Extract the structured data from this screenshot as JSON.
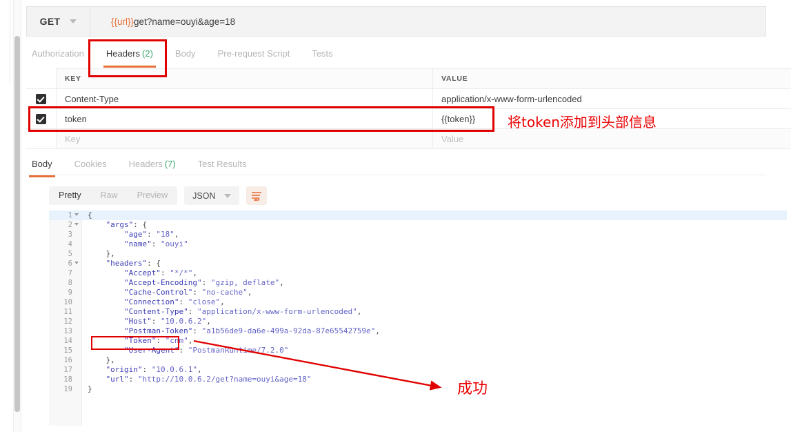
{
  "request": {
    "method": "GET",
    "url_variable": "{{url}}",
    "url_path": "get?name=ouyi&age=18",
    "tabs": [
      {
        "label": "Authorization",
        "count": "",
        "active": false
      },
      {
        "label": "Headers",
        "count": "(2)",
        "active": true
      },
      {
        "label": "Body",
        "count": "",
        "active": false
      },
      {
        "label": "Pre-request Script",
        "count": "",
        "active": false
      },
      {
        "label": "Tests",
        "count": "",
        "active": false
      }
    ]
  },
  "headers_table": {
    "columns": [
      "KEY",
      "VALUE"
    ],
    "rows": [
      {
        "checked": true,
        "key": "Content-Type",
        "value": "application/x-www-form-urlencoded",
        "value_is_variable": false,
        "placeholder": false
      },
      {
        "checked": true,
        "key": "token",
        "value": "{{token}}",
        "value_is_variable": true,
        "placeholder": false
      },
      {
        "checked": false,
        "key": "Key",
        "value": "Value",
        "value_is_variable": false,
        "placeholder": true
      }
    ]
  },
  "response": {
    "tabs": [
      {
        "label": "Body",
        "count": "",
        "active": true
      },
      {
        "label": "Cookies",
        "count": "",
        "active": false
      },
      {
        "label": "Headers",
        "count": "(7)",
        "active": false
      },
      {
        "label": "Test Results",
        "count": "",
        "active": false
      }
    ],
    "view_modes": [
      {
        "label": "Pretty",
        "active": true
      },
      {
        "label": "Raw",
        "active": false
      },
      {
        "label": "Preview",
        "active": false
      }
    ],
    "format": "JSON",
    "wrap_icon": "word-wrap-icon"
  },
  "code_lines": [
    {
      "n": "1",
      "fold": true,
      "active": true,
      "text": "{"
    },
    {
      "n": "2",
      "fold": true,
      "active": false,
      "text": "    \"args\": {"
    },
    {
      "n": "3",
      "fold": false,
      "active": false,
      "text": "        \"age\": \"18\","
    },
    {
      "n": "4",
      "fold": false,
      "active": false,
      "text": "        \"name\": \"ouyi\""
    },
    {
      "n": "5",
      "fold": false,
      "active": false,
      "text": "    },"
    },
    {
      "n": "6",
      "fold": true,
      "active": false,
      "text": "    \"headers\": {"
    },
    {
      "n": "7",
      "fold": false,
      "active": false,
      "text": "        \"Accept\": \"*/*\","
    },
    {
      "n": "8",
      "fold": false,
      "active": false,
      "text": "        \"Accept-Encoding\": \"gzip, deflate\","
    },
    {
      "n": "9",
      "fold": false,
      "active": false,
      "text": "        \"Cache-Control\": \"no-cache\","
    },
    {
      "n": "10",
      "fold": false,
      "active": false,
      "text": "        \"Connection\": \"close\","
    },
    {
      "n": "11",
      "fold": false,
      "active": false,
      "text": "        \"Content-Type\": \"application/x-www-form-urlencoded\","
    },
    {
      "n": "12",
      "fold": false,
      "active": false,
      "text": "        \"Host\": \"10.0.6.2\","
    },
    {
      "n": "13",
      "fold": false,
      "active": false,
      "text": "        \"Postman-Token\": \"a1b56de9-da6e-499a-92da-87e65542759e\","
    },
    {
      "n": "14",
      "fold": false,
      "active": false,
      "text": "        \"Token\": \"cnm\","
    },
    {
      "n": "15",
      "fold": false,
      "active": false,
      "text": "        \"User-Agent\": \"PostmanRuntime/7.2.0\""
    },
    {
      "n": "16",
      "fold": false,
      "active": false,
      "text": "    },"
    },
    {
      "n": "17",
      "fold": false,
      "active": false,
      "text": "    \"origin\": \"10.0.6.1\","
    },
    {
      "n": "18",
      "fold": false,
      "active": false,
      "text": "    \"url\": \"http://10.0.6.2/get?name=ouyi&age=18\""
    },
    {
      "n": "19",
      "fold": false,
      "active": false,
      "text": "}"
    }
  ],
  "annotations": {
    "header_note": "将token添加到头部信息",
    "success_note": "成功",
    "color": "#ea0000"
  }
}
